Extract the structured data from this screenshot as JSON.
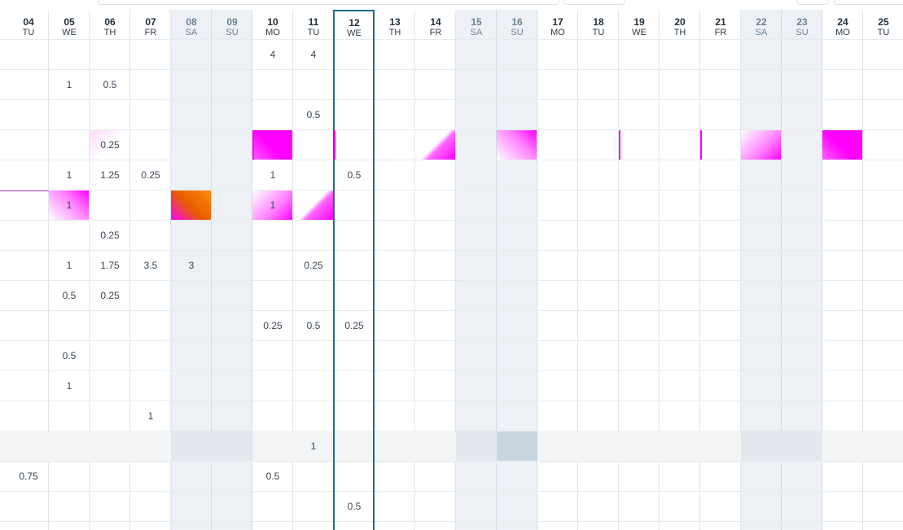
{
  "header": {
    "days": [
      {
        "day": "04",
        "dow": "TU",
        "weekend": false,
        "today": false
      },
      {
        "day": "05",
        "dow": "WE",
        "weekend": false,
        "today": false
      },
      {
        "day": "06",
        "dow": "TH",
        "weekend": false,
        "today": false
      },
      {
        "day": "07",
        "dow": "FR",
        "weekend": false,
        "today": false
      },
      {
        "day": "08",
        "dow": "SA",
        "weekend": true,
        "today": false
      },
      {
        "day": "09",
        "dow": "SU",
        "weekend": true,
        "today": false
      },
      {
        "day": "10",
        "dow": "MO",
        "weekend": false,
        "today": false
      },
      {
        "day": "11",
        "dow": "TU",
        "weekend": false,
        "today": false
      },
      {
        "day": "12",
        "dow": "WE",
        "weekend": false,
        "today": true
      },
      {
        "day": "13",
        "dow": "TH",
        "weekend": false,
        "today": false
      },
      {
        "day": "14",
        "dow": "FR",
        "weekend": false,
        "today": false
      },
      {
        "day": "15",
        "dow": "SA",
        "weekend": true,
        "today": false
      },
      {
        "day": "16",
        "dow": "SU",
        "weekend": true,
        "today": false
      },
      {
        "day": "17",
        "dow": "MO",
        "weekend": false,
        "today": false
      },
      {
        "day": "18",
        "dow": "TU",
        "weekend": false,
        "today": false
      },
      {
        "day": "19",
        "dow": "WE",
        "weekend": false,
        "today": false
      },
      {
        "day": "20",
        "dow": "TH",
        "weekend": false,
        "today": false
      },
      {
        "day": "21",
        "dow": "FR",
        "weekend": false,
        "today": false
      },
      {
        "day": "22",
        "dow": "SA",
        "weekend": true,
        "today": false
      },
      {
        "day": "23",
        "dow": "SU",
        "weekend": true,
        "today": false
      },
      {
        "day": "24",
        "dow": "MO",
        "weekend": false,
        "today": false
      },
      {
        "day": "25",
        "dow": "TU",
        "weekend": false,
        "today": false
      }
    ]
  },
  "colors": {
    "today_border": "#1d6b8f",
    "weekend_bg": "#edf1f5",
    "highlight_row_bg": "#f2f4f6",
    "accent_magenta": "#ff00ff",
    "accent_orange": "#e85a00"
  },
  "rows": [
    {
      "cells": [
        [
          "10",
          "4"
        ],
        [
          "11",
          "4"
        ]
      ]
    },
    {
      "cells": [
        [
          "05",
          "1"
        ],
        [
          "06",
          "0.5"
        ]
      ]
    },
    {
      "cells": [
        [
          "11",
          "0.5"
        ]
      ]
    },
    {
      "cells": [
        [
          "06",
          "0.25"
        ]
      ]
    },
    {
      "cells": [
        [
          "05",
          "1"
        ],
        [
          "06",
          "1.25"
        ],
        [
          "07",
          "0.25"
        ],
        [
          "10",
          "1"
        ],
        [
          "12",
          "0.5"
        ]
      ]
    },
    {
      "cells": [
        [
          "05",
          "1"
        ],
        [
          "10",
          "1"
        ]
      ]
    },
    {
      "cells": [
        [
          "06",
          "0.25"
        ]
      ]
    },
    {
      "cells": [
        [
          "05",
          "1"
        ],
        [
          "06",
          "1.75"
        ],
        [
          "07",
          "3.5"
        ],
        [
          "08",
          "3"
        ],
        [
          "11",
          "0.25"
        ]
      ]
    },
    {
      "cells": [
        [
          "05",
          "0.5"
        ],
        [
          "06",
          "0.25"
        ]
      ]
    },
    {
      "cells": [
        [
          "10",
          "0.25"
        ],
        [
          "11",
          "0.5"
        ],
        [
          "12",
          "0.25"
        ]
      ]
    },
    {
      "cells": [
        [
          "05",
          "0.5"
        ]
      ]
    },
    {
      "cells": [
        [
          "05",
          "1"
        ]
      ]
    },
    {
      "cells": [
        [
          "07",
          "1"
        ]
      ]
    },
    {
      "cells": [
        [
          "11",
          "1"
        ]
      ],
      "highlighted": true
    },
    {
      "cells": [
        [
          "04",
          "0.75"
        ],
        [
          "10",
          "0.5"
        ]
      ]
    },
    {
      "cells": [
        [
          "12",
          "0.5"
        ]
      ]
    }
  ]
}
